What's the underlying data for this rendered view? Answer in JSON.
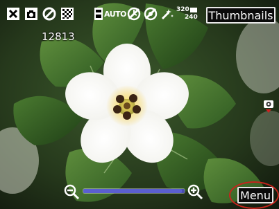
{
  "app": {
    "counter": "12813",
    "thumbnails_label": "Thumbnails",
    "menu_label": "Menu"
  },
  "top_icons": [
    {
      "name": "close-icon"
    },
    {
      "name": "camera-mode-icon"
    },
    {
      "name": "flash-off-icon"
    },
    {
      "name": "grid-pattern-icon"
    },
    {
      "name": "storage-card-icon"
    },
    {
      "name": "white-balance-auto-icon"
    },
    {
      "name": "timer-off-icon"
    },
    {
      "name": "burst-off-icon"
    },
    {
      "name": "effect-icon"
    },
    {
      "name": "resolution-320x240-icon"
    }
  ],
  "resolution": {
    "top": "320",
    "bottom": "240"
  },
  "white_balance": "AUTO",
  "zoom": {
    "level": 0.97
  },
  "colors": {
    "zoom_track": "#4a4eb1",
    "menu_highlight": "#c6241c",
    "button_bg": "#0b0b0b",
    "button_border": "#e8e8e8"
  }
}
